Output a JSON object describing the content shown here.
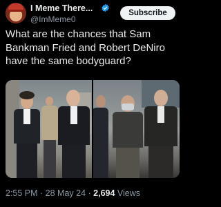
{
  "author": {
    "display_name": "I Meme There...",
    "handle": "@ImMeme0"
  },
  "subscribe_label": "Subscribe",
  "tweet": {
    "text": "What are the chances that  Sam Bankman Fried and Robert DeNiro have the same bodyguard?"
  },
  "meta": {
    "time": "2:55 PM",
    "separator": " · ",
    "date": "28 May 24",
    "views_count": "2,694",
    "views_label": " Views"
  },
  "colors": {
    "background": "#000000",
    "text": "#e7e9ea",
    "muted": "#8b98a5",
    "verified": "#1d9bf0",
    "button_bg": "#eff3f4"
  },
  "icons": {
    "verified": "verified-badge-icon"
  }
}
